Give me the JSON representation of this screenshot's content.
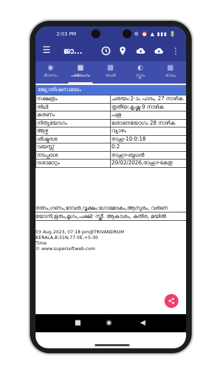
{
  "status": {
    "time": "2:03 PM",
    "icons": "⚙ ⏰ ▲ ▮▮▮ 🔋"
  },
  "appbar": {
    "title": "ജാ..."
  },
  "tabs": [
    {
      "label": "ദിവസം",
      "active": false
    },
    {
      "label": "പഞ്ചാംഗം",
      "active": true
    },
    {
      "label": "രാശി",
      "active": false
    },
    {
      "label": "സ്ഫുടം",
      "active": false
    },
    {
      "label": "ഭാവം",
      "active": false
    }
  ],
  "section_title": "ജ്യോതിഷസമയം",
  "rows": [
    {
      "label": "നക്ഷത്രം",
      "value": "ചതയം:2-ാം പാദം, 27 നാഴിക"
    },
    {
      "label": "തിഥി",
      "value": "തൃതീയ:കൃഷ്ണ 9 നാഴിക"
    },
    {
      "label": "കരണം",
      "value": "പശു"
    },
    {
      "label": "നിത്യയോഗം",
      "value": "ശോഭനയോഗം 28 നാഴിക"
    },
    {
      "label": "ആഴ്ച",
      "value": "വ്യാഴം"
    },
    {
      "label": "ശിഷ്ടദശ",
      "value": "രാഹു-10:0:18"
    },
    {
      "label": "വയസ്സ്",
      "value": "0:2"
    },
    {
      "label": "നടപ്പുദശ",
      "value": "രാഹു>ബുധൻ"
    },
    {
      "label": "ദശാമാറ്റം",
      "value": "20/02/2026,രാഹു>കേതു"
    }
  ],
  "wide_lines": [
    "രത്നം,ഗണം,ദേവത,വൃക്ഷം:ഗോമേദകം,ആസുരം, വരുണ",
    "യോനി,ഭൂതം,മൃഗം,പക്ഷി: സ്ത്രീ. ആകാശം, കുതിര, മയിൽ"
  ],
  "footer": {
    "line1": "03 Aug 2023, 07:18 pm@TRIVANDRUM  KERALA,8:31N,77:0E,+5:30",
    "line2": "Time",
    "line3": "© www.supersoftweb.com"
  }
}
